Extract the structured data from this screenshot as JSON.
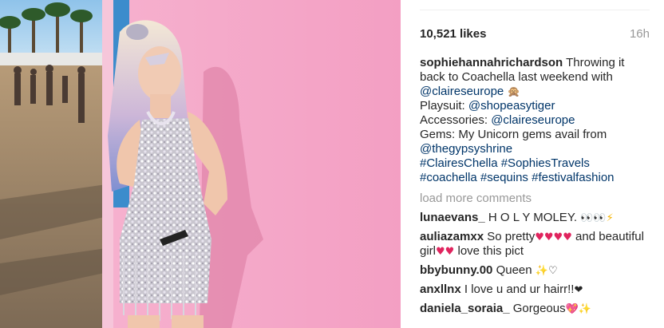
{
  "post": {
    "photo_alt": "Woman in sequin playsuit against pink wall at festival",
    "likes": "10,521 likes",
    "time": "16h"
  },
  "caption": {
    "username": "sophiehannahrichardson",
    "lines": [
      {
        "parts": [
          {
            "t": " Throwing it"
          }
        ]
      },
      {
        "parts": [
          {
            "t": "back to Coachella last weekend with"
          }
        ]
      },
      {
        "parts": [
          {
            "t": "@claireseurope",
            "link": true
          },
          {
            "t": " "
          },
          {
            "t": "🙊",
            "emoji": "monkey"
          }
        ]
      },
      {
        "parts": [
          {
            "t": "Playsuit: "
          },
          {
            "t": "@shopeasytiger",
            "link": true
          }
        ]
      },
      {
        "parts": [
          {
            "t": "Accessories: "
          },
          {
            "t": "@claireseurope",
            "link": true
          }
        ]
      },
      {
        "parts": [
          {
            "t": "Gems: My Unicorn gems avail from"
          }
        ]
      },
      {
        "parts": [
          {
            "t": "@thegypsyshrine",
            "link": true
          }
        ]
      },
      {
        "parts": [
          {
            "t": "#ClairesChella",
            "link": true
          },
          {
            "t": " "
          },
          {
            "t": "#SophiesTravels",
            "link": true
          }
        ]
      },
      {
        "parts": [
          {
            "t": "#coachella",
            "link": true
          },
          {
            "t": " "
          },
          {
            "t": "#sequins",
            "link": true
          },
          {
            "t": " "
          },
          {
            "t": "#festivalfashion",
            "link": true
          }
        ]
      }
    ]
  },
  "load_more": "load more comments",
  "comments": [
    {
      "user": "lunaevans_",
      "lines": [
        [
          {
            "t": " H O L Y MOLEY. "
          },
          {
            "t": "👀👀",
            "emoji": "eyes"
          },
          {
            "t": "⚡",
            "emoji": "bolt"
          }
        ]
      ]
    },
    {
      "user": "auliazamxx",
      "lines": [
        [
          {
            "t": " So pretty"
          },
          {
            "t": "♥♥♥♥",
            "emoji": "hearts"
          },
          {
            "t": " and beautiful"
          }
        ],
        [
          {
            "t": "girl"
          },
          {
            "t": "♥♥",
            "emoji": "hearts"
          },
          {
            "t": " love this pict"
          }
        ]
      ]
    },
    {
      "user": "bbybunny.00",
      "lines": [
        [
          {
            "t": " Queen "
          },
          {
            "t": "✨",
            "emoji": "sparkles"
          },
          {
            "t": "♡",
            "emoji": "whiteheart"
          }
        ]
      ]
    },
    {
      "user": "anxllnx",
      "lines": [
        [
          {
            "t": " I love u and ur hairr!!"
          },
          {
            "t": "❤",
            "emoji": "blackheart"
          }
        ]
      ]
    },
    {
      "user": "daniela_soraia_",
      "lines": [
        [
          {
            "t": " Gorgeous"
          },
          {
            "t": "💖",
            "emoji": "sparkleheart"
          },
          {
            "t": "✨",
            "emoji": "sparkles"
          }
        ]
      ]
    }
  ],
  "colors": {
    "link": "#003569",
    "text": "#262626",
    "muted": "#999999",
    "wall_pink": "#f4a9c9"
  }
}
